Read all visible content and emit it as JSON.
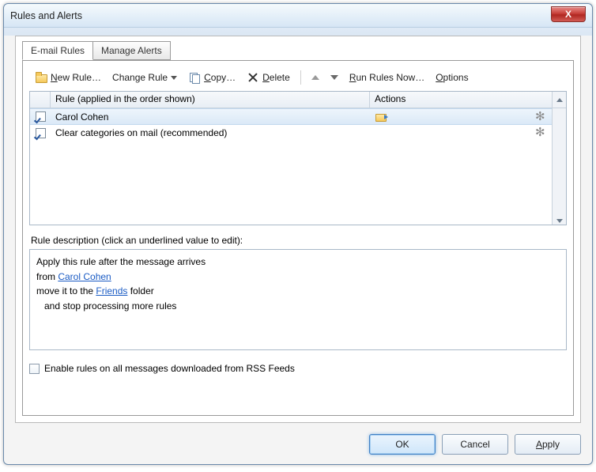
{
  "window": {
    "title": "Rules and Alerts",
    "close": "X"
  },
  "tabs": {
    "email_rules": "E-mail Rules",
    "manage_alerts": "Manage Alerts"
  },
  "toolbar": {
    "new_rule_pre": "N",
    "new_rule_rest": "ew Rule…",
    "change_rule": "Change Rule",
    "copy_pre": "C",
    "copy_rest": "opy…",
    "delete_pre": "D",
    "delete_rest": "elete",
    "run_pre": "R",
    "run_rest": "un Rules Now…",
    "options_pre": "O",
    "options_rest": "ptions"
  },
  "list": {
    "col_rule": "Rule (applied in the order shown)",
    "col_actions": "Actions",
    "rows": [
      {
        "checked": true,
        "name": "Carol Cohen",
        "has_move_icon": true
      },
      {
        "checked": true,
        "name": "Clear categories on mail (recommended)",
        "has_move_icon": false
      }
    ]
  },
  "desc": {
    "label": "Rule description (click an underlined value to edit):",
    "line1": "Apply this rule after the message arrives",
    "from_prefix": "from ",
    "from_link": "Carol Cohen",
    "move_prefix": "move it to the ",
    "move_link": "Friends",
    "move_suffix": " folder",
    "stop": "and stop processing more rules"
  },
  "rss": {
    "label": "Enable rules on all messages downloaded from RSS Feeds"
  },
  "buttons": {
    "ok": "OK",
    "cancel": "Cancel",
    "apply_pre": "A",
    "apply_rest": "pply"
  }
}
